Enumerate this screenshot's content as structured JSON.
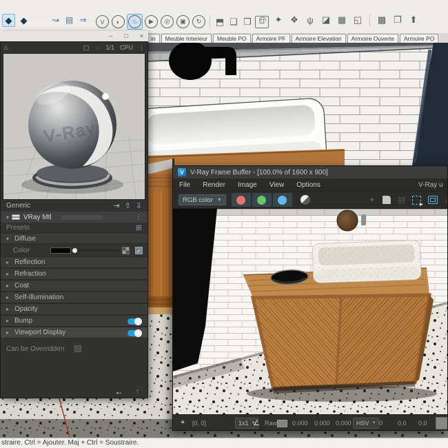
{
  "app": {
    "window_controls": {
      "minimize": "–",
      "maximize": "□",
      "close": "×"
    },
    "scene_tabs": [
      {
        "label": "in"
      },
      {
        "label": "Meuble Interieur"
      },
      {
        "label": "Meuble PO"
      },
      {
        "label": "Armoire PF"
      },
      {
        "label": "Armoire Elevation"
      },
      {
        "label": "Armoire Ouverte"
      },
      {
        "label": "Armoire PO"
      }
    ],
    "status_bar_text": "straire. Ctrl = Ajouter. Maj + Ctrl = Soustraire."
  },
  "main_toolbar": {
    "cube_icons": [
      {
        "glyph": "◆"
      },
      {
        "glyph": "◆"
      }
    ],
    "util_icons": [
      {
        "glyph": "↝"
      },
      {
        "glyph": "▤"
      },
      {
        "glyph": "⇒"
      }
    ],
    "vray_icons": [
      {
        "glyph": "V"
      },
      {
        "glyph": "◐"
      },
      {
        "glyph": "♨"
      },
      {
        "glyph": "▶"
      },
      {
        "glyph": "◎"
      },
      {
        "glyph": "▣"
      },
      {
        "glyph": "↻"
      }
    ],
    "frame_icons": [
      {
        "glyph": "⬒"
      },
      {
        "glyph": "❏"
      },
      {
        "glyph": "❐"
      }
    ],
    "lock_icon": "⊡",
    "object_icons": [
      {
        "glyph": "◠"
      },
      {
        "glyph": "✦"
      },
      {
        "glyph": "❖"
      },
      {
        "glyph": "ψ"
      },
      {
        "glyph": "◪"
      },
      {
        "glyph": "▦"
      },
      {
        "glyph": "◱"
      },
      {
        "glyph": "▩"
      },
      {
        "glyph": "❐"
      },
      {
        "glyph": "⬆"
      }
    ]
  },
  "asset_editor": {
    "preview_header": {
      "left_icon": "♨",
      "frame_icon": "▢",
      "teapot_icon": "♨",
      "ratio": "1/1",
      "engine": "CPU",
      "menu_icon": "⋮"
    },
    "watermark": "V-Ray",
    "generic": {
      "label": "Generic",
      "icons": [
        "⇥",
        "⇧",
        "⇩"
      ]
    },
    "material": {
      "arrow": "▾",
      "label": "VRay Mtl",
      "menu_icon": "⋮"
    },
    "presets": {
      "label": "Presets",
      "icon": "⊞"
    },
    "sections": [
      {
        "arrow": "▾",
        "label": "Diffuse"
      },
      {
        "arrow": "▸",
        "label": "Reflection"
      },
      {
        "arrow": "▸",
        "label": "Refraction"
      },
      {
        "arrow": "▸",
        "label": "Coat"
      },
      {
        "arrow": "▸",
        "label": "Self-Illumination"
      },
      {
        "arrow": "▸",
        "label": "Opacity"
      },
      {
        "arrow": "▸",
        "label": "Bump",
        "toggle": "on"
      },
      {
        "arrow": "▸",
        "label": "Viewport Display",
        "toggle": "on"
      }
    ],
    "color_row": {
      "label": "Color",
      "checkmark": "✓"
    },
    "override": {
      "label": "Can be Overridden"
    },
    "footer_icons": {
      "back": "←",
      "up": "↑"
    }
  },
  "vfb": {
    "title": "V-Ray Frame Buffer - [100.0% of 1600 x 900]",
    "logo_letter": "V",
    "menu": [
      {
        "label": "File"
      },
      {
        "label": "Render"
      },
      {
        "label": "Image"
      },
      {
        "label": "View"
      },
      {
        "label": "Options"
      }
    ],
    "menu_right_text": "V-Ray u",
    "channel_combo": "RGB color",
    "combo_arrow": "▼",
    "lens_icon": "✦",
    "teapot_icon": "♨",
    "export_icon": "▤",
    "status": {
      "pin_icon": "⌖",
      "coords": "[0, 0]",
      "zoom": "1x1",
      "curve_icon": "∠",
      "raw_label": "Raw",
      "r": "0.000",
      "g": "0.000",
      "b": "0.000",
      "mode": "HSV",
      "h": "0",
      "s": "0.0",
      "v": "0.0"
    }
  },
  "colors": {
    "accent_blue": "#1e9fe0",
    "dot_red": "#e57370",
    "dot_green": "#67c469",
    "dot_blue": "#66b8ea"
  }
}
